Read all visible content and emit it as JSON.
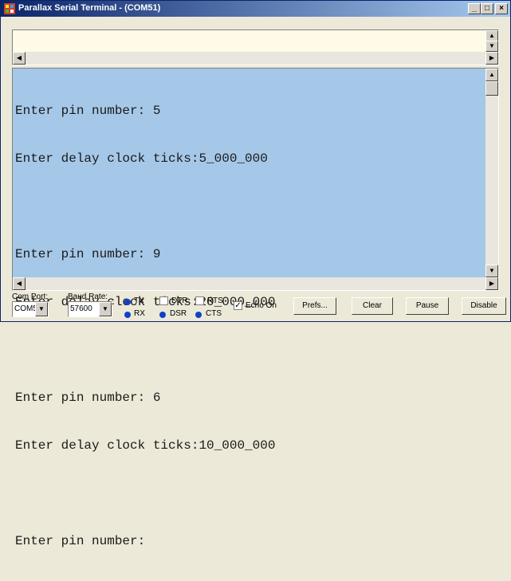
{
  "window": {
    "title": "Parallax Serial Terminal - (COM51)"
  },
  "titlebar_buttons": {
    "minimize": "_",
    "maximize": "□",
    "close": "×"
  },
  "transmit": {
    "value": ""
  },
  "receive": {
    "lines": [
      "Enter pin number: 5",
      "Enter delay clock ticks:5_000_000",
      "",
      "Enter pin number: 9",
      "Enter delay clock ticks:20_000_000",
      "",
      "Enter pin number: 6",
      "Enter delay clock ticks:10_000_000",
      "",
      "Enter pin number:"
    ]
  },
  "toolbar": {
    "com_port_label": "Com Port:",
    "com_port_value": "COM51",
    "baud_rate_label": "Baud Rate:",
    "baud_rate_value": "57600",
    "tx_label": "TX",
    "rx_label": "RX",
    "dtr_label": "DTR",
    "dsr_label": "DSR",
    "rts_label": "RTS",
    "cts_label": "CTS",
    "echo_label": "Echo On",
    "echo_checked": true,
    "prefs_label": "Prefs...",
    "clear_label": "Clear",
    "pause_label": "Pause",
    "disable_label": "Disable"
  },
  "colors": {
    "led": "#1240c8",
    "transmit_bg": "#fffbe6",
    "receive_bg": "#a6c8e8",
    "title_start": "#0a246a"
  }
}
